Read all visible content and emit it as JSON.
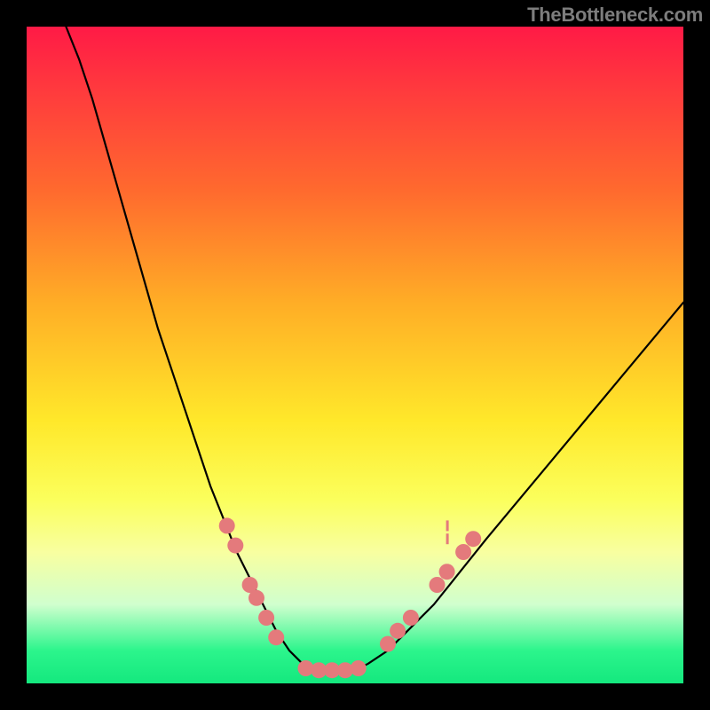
{
  "watermark": "TheBottleneck.com",
  "chart_data": {
    "type": "line",
    "title": "",
    "xlabel": "",
    "ylabel": "",
    "xlim": [
      0,
      100
    ],
    "ylim": [
      0,
      100
    ],
    "series": [
      {
        "name": "bottleneck-curve",
        "x": [
          6,
          8,
          10,
          12,
          14,
          16,
          18,
          20,
          22,
          24,
          26,
          28,
          30,
          32,
          34,
          36,
          38,
          40,
          42,
          44,
          46,
          48,
          50,
          52,
          55,
          58,
          62,
          66,
          70,
          75,
          80,
          85,
          90,
          95,
          100
        ],
        "y": [
          100,
          95,
          89,
          82,
          75,
          68,
          61,
          54,
          48,
          42,
          36,
          30,
          25,
          20,
          16,
          12,
          8,
          5,
          3,
          2,
          2,
          2,
          2,
          3,
          5,
          8,
          12,
          17,
          22,
          28,
          34,
          40,
          46,
          52,
          58
        ]
      }
    ],
    "markers": [
      {
        "name": "left-1",
        "x": 30.5,
        "y": 24
      },
      {
        "name": "left-2",
        "x": 31.8,
        "y": 21
      },
      {
        "name": "left-3",
        "x": 34.0,
        "y": 15
      },
      {
        "name": "left-4",
        "x": 35.0,
        "y": 13
      },
      {
        "name": "left-5",
        "x": 36.5,
        "y": 10
      },
      {
        "name": "left-6",
        "x": 38.0,
        "y": 7
      },
      {
        "name": "flat-1",
        "x": 42.5,
        "y": 2.3
      },
      {
        "name": "flat-2",
        "x": 44.5,
        "y": 2.0
      },
      {
        "name": "flat-3",
        "x": 46.5,
        "y": 2.0
      },
      {
        "name": "flat-4",
        "x": 48.5,
        "y": 2.0
      },
      {
        "name": "flat-5",
        "x": 50.5,
        "y": 2.3
      },
      {
        "name": "right-1",
        "x": 55.0,
        "y": 6
      },
      {
        "name": "right-2",
        "x": 56.5,
        "y": 8
      },
      {
        "name": "right-3",
        "x": 58.5,
        "y": 10
      },
      {
        "name": "right-4",
        "x": 62.5,
        "y": 15
      },
      {
        "name": "right-5",
        "x": 64.0,
        "y": 17
      },
      {
        "name": "right-6",
        "x": 66.5,
        "y": 20
      },
      {
        "name": "right-7",
        "x": 68.0,
        "y": 22
      }
    ],
    "small-marks": [
      {
        "x": 64.0,
        "y": 22
      },
      {
        "x": 64.0,
        "y": 24
      }
    ]
  }
}
